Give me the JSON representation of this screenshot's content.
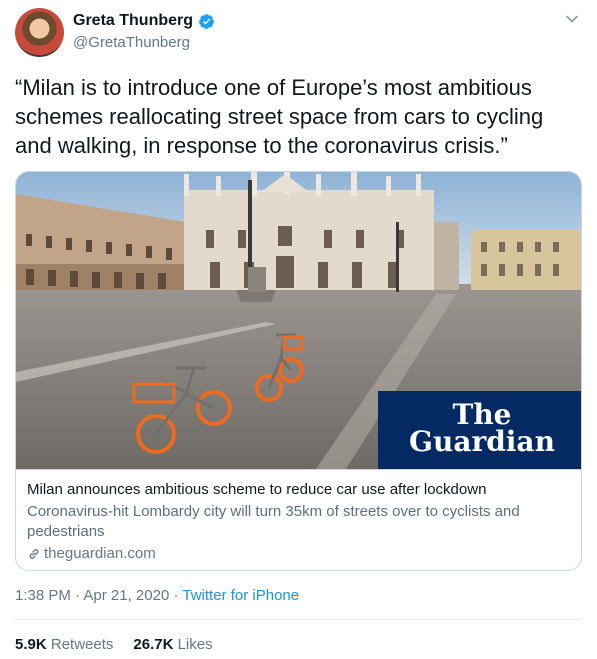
{
  "user": {
    "name": "Greta Thunberg",
    "handle": "@GretaThunberg"
  },
  "tweet": {
    "text": "“Milan is to introduce one of Europe’s most ambitious schemes reallocating street space from cars to cycling and walking, in response to the coronavirus crisis.”"
  },
  "card": {
    "logo_line1": "The",
    "logo_line2": "Guardian",
    "title": "Milan announces ambitious scheme to reduce car use after lockdown",
    "description": "Coronavirus-hit Lombardy city will turn 35km of streets over to cyclists and pedestrians",
    "domain": "theguardian.com"
  },
  "meta": {
    "time": "1:38 PM",
    "separator": "·",
    "date": "Apr 21, 2020",
    "source": "Twitter for iPhone"
  },
  "stats": {
    "retweets_count": "5.9K",
    "retweets_label": "Retweets",
    "likes_count": "26.7K",
    "likes_label": "Likes"
  },
  "colors": {
    "accent": "#1b95e0",
    "guardian_blue": "#052962",
    "bike_orange": "#ee6a1f"
  },
  "icons": [
    "verified-badge-icon",
    "chevron-down-icon",
    "link-icon"
  ]
}
